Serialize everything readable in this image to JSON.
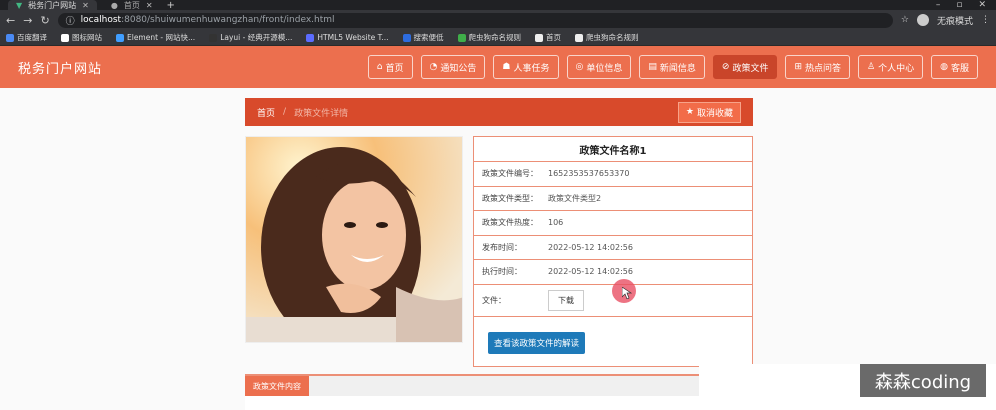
{
  "browser": {
    "tabs": [
      {
        "label": "税务门户网站"
      },
      {
        "label": "首页"
      }
    ],
    "url_host": "localhost",
    "url_path": ":8080/shuiwumenhuwangzhan/front/index.html",
    "incognito_label": "无痕模式",
    "bookmarks": [
      {
        "label": "百度翻译",
        "color": "#4a8af4"
      },
      {
        "label": "图标网站",
        "color": "#ffffff"
      },
      {
        "label": "Element - 网站快...",
        "color": "#409eff"
      },
      {
        "label": "Layui - 经典开源模...",
        "color": "#333333"
      },
      {
        "label": "HTML5 Website T...",
        "color": "#5b6cff"
      },
      {
        "label": "搜索便低",
        "color": "#2d6cdf"
      },
      {
        "label": "爬虫狗命名规则",
        "color": "#3fae49"
      },
      {
        "label": "首页",
        "color": "#eeeeee"
      },
      {
        "label": "爬虫狗命名规则",
        "color": "#eeeeee"
      }
    ]
  },
  "header": {
    "site_title": "税务门户网站",
    "nav": [
      {
        "label": "首页",
        "icon": "home-icon"
      },
      {
        "label": "通知公告",
        "icon": "bell-icon"
      },
      {
        "label": "人事任务",
        "icon": "users-icon"
      },
      {
        "label": "单位信息",
        "icon": "pin-icon"
      },
      {
        "label": "新闻信息",
        "icon": "news-icon"
      },
      {
        "label": "政策文件",
        "icon": "policy-icon",
        "active": true
      },
      {
        "label": "热点问答",
        "icon": "qa-icon"
      },
      {
        "label": "个人中心",
        "icon": "user-icon"
      },
      {
        "label": "客服",
        "icon": "chat-icon"
      }
    ]
  },
  "breadcrumb": {
    "home": "首页",
    "separator": "/",
    "current": "政策文件详情"
  },
  "favorite_button": "取消收藏",
  "detail": {
    "title": "政策文件名称1",
    "rows": [
      {
        "key": "政策文件编号：",
        "value": "1652353537653370"
      },
      {
        "key": "政策文件类型：",
        "value": "政策文件类型2"
      },
      {
        "key": "政策文件热度：",
        "value": "106"
      },
      {
        "key": "发布时间：",
        "value": "2022-05-12 14:02:56"
      },
      {
        "key": "执行时间：",
        "value": "2022-05-12 14:02:56"
      }
    ],
    "file_label": "文件：",
    "download_label": "下载",
    "view_button": "查看该政策文件的解读"
  },
  "content_tab": "政策文件内容",
  "watermark": "森森coding",
  "colors": {
    "header_bg": "#ec6f4e",
    "active_nav": "#c9452a",
    "crumb_bg": "#d84a2b",
    "border_accent": "#ec8f76",
    "view_button": "#1e7ab9"
  }
}
